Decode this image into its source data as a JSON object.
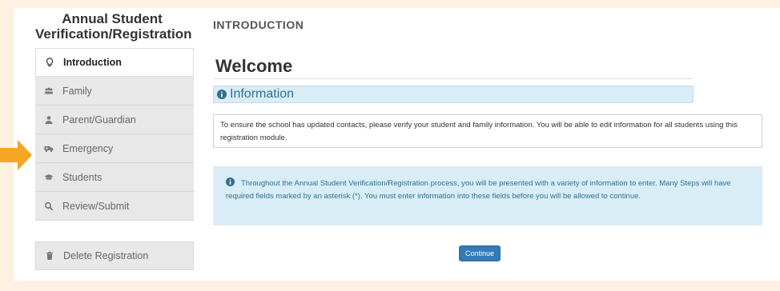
{
  "sidebar": {
    "title": "Annual Student Verification/Registration",
    "items": [
      {
        "label": "Introduction",
        "icon": "lightbulb-icon",
        "active": true
      },
      {
        "label": "Family",
        "icon": "users-icon",
        "active": false
      },
      {
        "label": "Parent/Guardian",
        "icon": "user-icon",
        "active": false
      },
      {
        "label": "Emergency",
        "icon": "ambulance-icon",
        "active": false
      },
      {
        "label": "Students",
        "icon": "graduation-cap-icon",
        "active": false
      },
      {
        "label": "Review/Submit",
        "icon": "search-icon",
        "active": false
      }
    ],
    "delete": {
      "label": "Delete Registration",
      "icon": "trash-icon"
    }
  },
  "main": {
    "section": "INTRODUCTION",
    "heading": "Welcome",
    "info_title": "Information",
    "info_text": "To ensure the school has updated contacts, please verify your student and family information. You will be able to edit information for all students using this registration module.",
    "notice_text": "Throughout the Annual Student Verification/Registration process, you will be presented with a variety of information to enter. Many Steps will have required fields marked by an asterisk (*). You must enter information into these fields before you will be allowed to continue.",
    "continue_label": "Continue"
  },
  "colors": {
    "background": "#fdf1e1",
    "arrow": "#f5a623",
    "info_blue": "#d9edf7",
    "info_text": "#31708f",
    "button": "#337ab7"
  }
}
